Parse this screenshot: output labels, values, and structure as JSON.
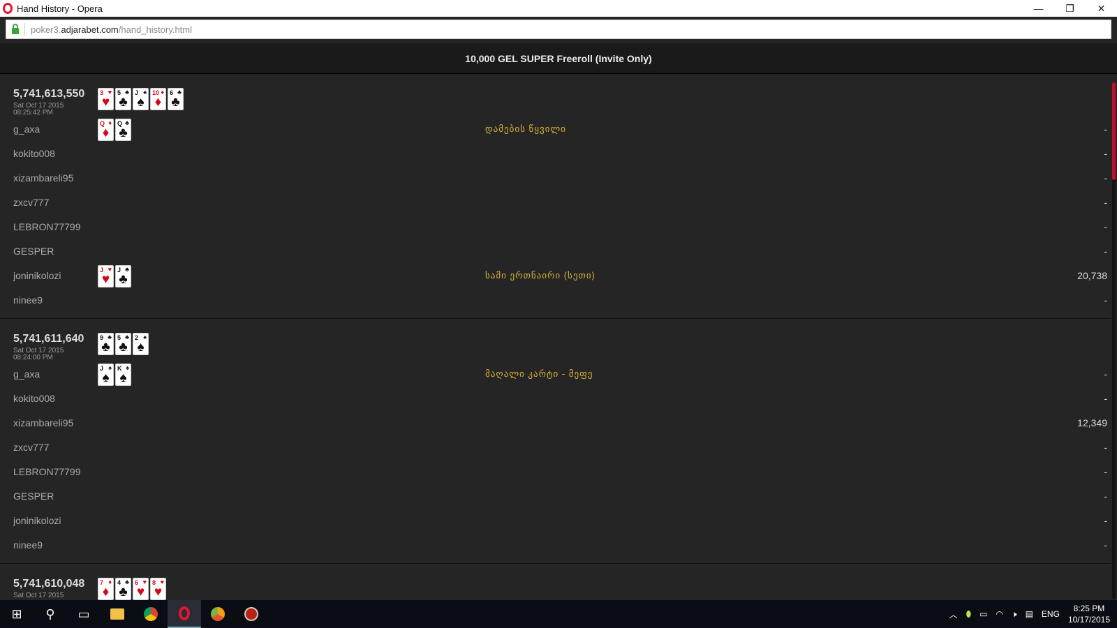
{
  "window": {
    "title": "Hand History - Opera",
    "minimize": "—",
    "restore": "❐",
    "close": "✕"
  },
  "address": {
    "sub": "poker3.",
    "domain": "adjarabet.com",
    "path": "/hand_history.html"
  },
  "header": {
    "title": "10,000 GEL SUPER Freeroll (Invite Only)"
  },
  "hands": [
    {
      "id": "5,741,613,550",
      "date": "Sat Oct 17 2015",
      "time": "08:25:42 PM",
      "board": [
        [
          "3",
          "h"
        ],
        [
          "5",
          "c"
        ],
        [
          "J",
          "s"
        ],
        [
          "10",
          "d"
        ],
        [
          "6",
          "c"
        ]
      ],
      "players": [
        {
          "name": "g_axa",
          "cards": [
            [
              "Q",
              "d"
            ],
            [
              "Q",
              "c"
            ]
          ],
          "hand": "დამების წყვილი",
          "amount": "-"
        },
        {
          "name": "kokito008",
          "amount": "-"
        },
        {
          "name": "xizambareli95",
          "amount": "-"
        },
        {
          "name": "zxcv777",
          "amount": "-"
        },
        {
          "name": "LEBRON77799",
          "amount": "-"
        },
        {
          "name": "GESPER",
          "amount": "-"
        },
        {
          "name": "joninikolozi",
          "cards": [
            [
              "J",
              "h"
            ],
            [
              "J",
              "c"
            ]
          ],
          "hand": "სამი ერთნაირი (სეთი)",
          "amount": "20,738"
        },
        {
          "name": "ninee9",
          "amount": "-"
        }
      ]
    },
    {
      "id": "5,741,611,640",
      "date": "Sat Oct 17 2015",
      "time": "08:24:00 PM",
      "board": [
        [
          "9",
          "c"
        ],
        [
          "5",
          "c"
        ],
        [
          "2",
          "s"
        ]
      ],
      "players": [
        {
          "name": "g_axa",
          "cards": [
            [
              "J",
              "s"
            ],
            [
              "K",
              "s"
            ]
          ],
          "hand": "მაღალი კარტი - მეფე",
          "amount": "-"
        },
        {
          "name": "kokito008",
          "amount": "-"
        },
        {
          "name": "xizambareli95",
          "amount": "12,349"
        },
        {
          "name": "zxcv777",
          "amount": "-"
        },
        {
          "name": "LEBRON77799",
          "amount": "-"
        },
        {
          "name": "GESPER",
          "amount": "-"
        },
        {
          "name": "joninikolozi",
          "amount": "-"
        },
        {
          "name": "ninee9",
          "amount": "-"
        }
      ]
    },
    {
      "id": "5,741,610,048",
      "date": "Sat Oct 17 2015",
      "time": "",
      "board": [
        [
          "7",
          "d"
        ],
        [
          "4",
          "c"
        ],
        [
          "6",
          "h"
        ],
        [
          "8",
          "h"
        ]
      ],
      "players": []
    }
  ],
  "taskbar": {
    "icons": [
      "windows-start-icon",
      "search-icon",
      "task-view-icon",
      "file-explorer-icon",
      "chrome-icon",
      "opera-icon",
      "chrome-canary-icon",
      "app-icon"
    ],
    "tray": {
      "lang": "ENG",
      "time": "8:25 PM",
      "date": "10/17/2015"
    }
  }
}
